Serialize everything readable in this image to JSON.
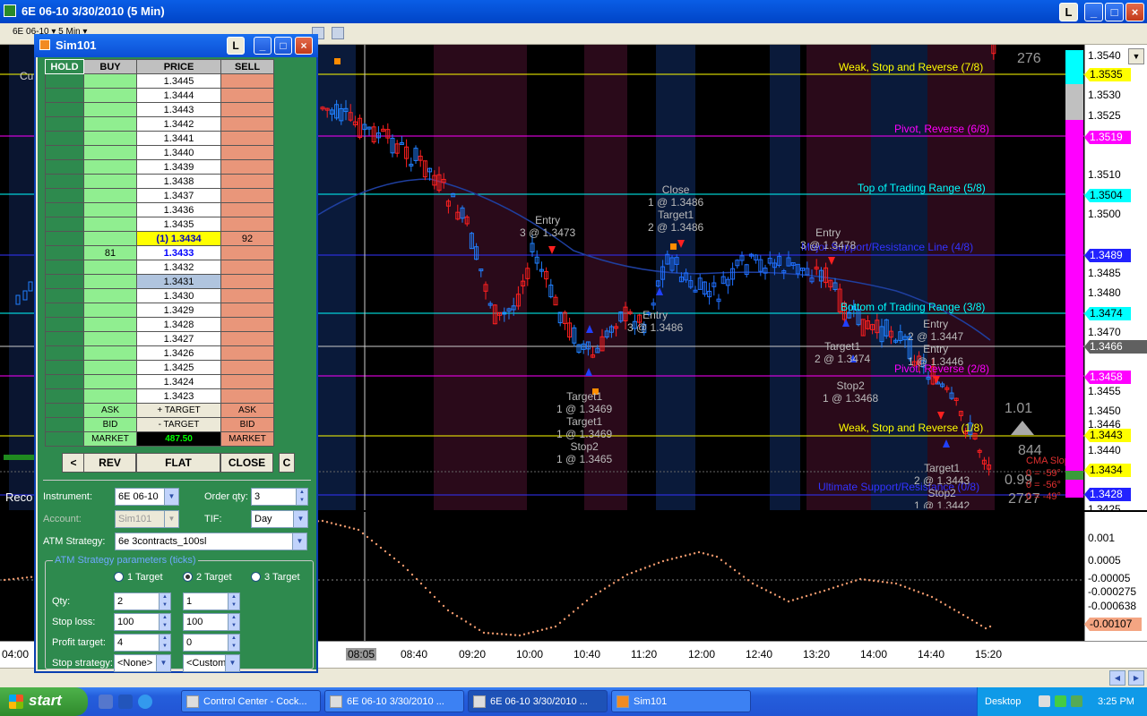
{
  "window": {
    "title": "6E 06-10  3/30/2010 (5 Min)",
    "btn_l": "L",
    "btn_min": "_",
    "btn_max": "□",
    "btn_close": "×"
  },
  "toolbar": {
    "instrument_tab": "6E 06-10 ▾ 5 Min ▾"
  },
  "chart": {
    "levels": [
      {
        "label": "Weak, Stop and Reverse (7/8)",
        "price": "1.3535",
        "color": "#ffff00"
      },
      {
        "label": "Pivot, Reverse (6/8)",
        "price": "1.3519",
        "color": "#ff00ff"
      },
      {
        "label": "Top of Trading Range (5/8)",
        "price": "1.3504",
        "color": "#00ffff"
      },
      {
        "label": "Major Support/Resistance Line (4/8)",
        "price": "1.3489",
        "color": "#3333ff"
      },
      {
        "label": "Bottom of Trading Range (3/8)",
        "price": "1.3474",
        "color": "#00ffff"
      },
      {
        "label": "Pivot, Reverse (2/8)",
        "price": "1.3458",
        "color": "#ff00ff"
      },
      {
        "label": "Weak, Stop and Reverse (1/8)",
        "price": "1.3443",
        "color": "#ffff00"
      },
      {
        "label": "Ultimate Support/Resistance (0/8)",
        "price": "1.3428",
        "color": "#3333ff"
      }
    ],
    "price_ticks": [
      "1.3540",
      "1.3530",
      "1.3525",
      "1.3510",
      "1.3500",
      "1.3485",
      "1.3480",
      "1.3470",
      "1.3455",
      "1.3450",
      "1.3446",
      "1.3440",
      "1.3425"
    ],
    "current_price": "1.3466",
    "last_price": "1.3434",
    "annotations": [
      {
        "text": "Entry\n3 @ 1.3473"
      },
      {
        "text": "Close\n1 @ 1.3486\nTarget1\n2 @ 1.3486"
      },
      {
        "text": "Entry\n3 @ 1.3478"
      },
      {
        "text": "Entry\n3 @ 1.3486"
      },
      {
        "text": "Target1\n1 @ 1.3469\nTarget1\n1 @ 1.3469\nStop2\n1 @ 1.3465"
      },
      {
        "text": "Target1\n2 @ 1.3474"
      },
      {
        "text": "Stop2\n1 @ 1.3468"
      },
      {
        "text": "Entry\n2 @ 1.3447\nEntry\n1 @ 1.3446"
      },
      {
        "text": "Target1\n2 @ 1.3443\nStop2\n1 @ 1.3442"
      }
    ],
    "stat_276": "276",
    "stat_101": "1.01",
    "stat_844": "844",
    "stat_099": "0.99",
    "stat_2727": "2727",
    "cma_title": "CMA Slope",
    "cma_lines": [
      "0 = -59°",
      "0 = -56°",
      "0 = -49°"
    ],
    "record_label": "Reco",
    "top_left_label": "Cu"
  },
  "indicator": {
    "ticks": [
      "0.001",
      "0.0005",
      "-0.00005",
      "-0.000275",
      "-0.000638"
    ],
    "value": "-0.00107"
  },
  "time_axis": [
    "04:00",
    "08:05",
    "08:40",
    "09:20",
    "10:00",
    "10:40",
    "11:20",
    "12:00",
    "12:40",
    "13:20",
    "14:00",
    "14:40",
    "15:20"
  ],
  "dom": {
    "title": "Sim101",
    "btn_l": "L",
    "headers": {
      "hold": "HOLD",
      "buy": "BUY",
      "price": "PRICE",
      "sell": "SELL"
    },
    "rows": [
      {
        "price": "1.3445",
        "buy": "",
        "sell": ""
      },
      {
        "price": "1.3444",
        "buy": "",
        "sell": ""
      },
      {
        "price": "1.3443",
        "buy": "",
        "sell": ""
      },
      {
        "price": "1.3442",
        "buy": "",
        "sell": ""
      },
      {
        "price": "1.3441",
        "buy": "",
        "sell": ""
      },
      {
        "price": "1.3440",
        "buy": "",
        "sell": ""
      },
      {
        "price": "1.3439",
        "buy": "",
        "sell": ""
      },
      {
        "price": "1.3438",
        "buy": "",
        "sell": ""
      },
      {
        "price": "1.3437",
        "buy": "",
        "sell": ""
      },
      {
        "price": "1.3436",
        "buy": "",
        "sell": ""
      },
      {
        "price": "1.3435",
        "buy": "",
        "sell": ""
      },
      {
        "price": "(1) 1.3434",
        "buy": "",
        "sell": "92"
      },
      {
        "price": "1.3433",
        "buy": "81",
        "sell": ""
      },
      {
        "price": "1.3432",
        "buy": "",
        "sell": ""
      },
      {
        "price": "1.3431",
        "buy": "",
        "sell": ""
      },
      {
        "price": "1.3430",
        "buy": "",
        "sell": ""
      },
      {
        "price": "1.3429",
        "buy": "",
        "sell": ""
      },
      {
        "price": "1.3428",
        "buy": "",
        "sell": ""
      },
      {
        "price": "1.3427",
        "buy": "",
        "sell": ""
      },
      {
        "price": "1.3426",
        "buy": "",
        "sell": ""
      },
      {
        "price": "1.3425",
        "buy": "",
        "sell": ""
      },
      {
        "price": "1.3424",
        "buy": "",
        "sell": ""
      },
      {
        "price": "1.3423",
        "buy": "",
        "sell": ""
      }
    ],
    "ask": "ASK",
    "plus_target": "+ TARGET",
    "bid": "BID",
    "minus_target": "- TARGET",
    "market": "MARKET",
    "pnl": "487.50",
    "btn_left": "<",
    "btn_rev": "REV",
    "btn_flat": "FLAT",
    "btn_close": "CLOSE",
    "btn_c": "C",
    "instrument_label": "Instrument:",
    "instrument_value": "6E 06-10",
    "order_qty_label": "Order qty:",
    "order_qty_value": "3",
    "account_label": "Account:",
    "account_value": "Sim101",
    "tif_label": "TIF:",
    "tif_value": "Day",
    "atm_label": "ATM Strategy:",
    "atm_value": "6e 3contracts_100sl",
    "atm_params_legend": "ATM Strategy parameters (ticks)",
    "radio1": "1 Target",
    "radio2": "2 Target",
    "radio3": "3 Target",
    "qty_label": "Qty:",
    "qty1": "2",
    "qty2": "1",
    "stop_label": "Stop loss:",
    "stop1": "100",
    "stop2": "100",
    "profit_label": "Profit target:",
    "profit1": "4",
    "profit2": "0",
    "strategy_label": "Stop strategy:",
    "strategy1": "<None>",
    "strategy2": "<Custom>"
  },
  "taskbar": {
    "start": "start",
    "items": [
      "Control Center - Cock...",
      "6E 06-10  3/30/2010 ...",
      "6E 06-10  3/30/2010 ...",
      "Sim101"
    ],
    "desktop": "Desktop",
    "clock": "3:25 PM"
  }
}
